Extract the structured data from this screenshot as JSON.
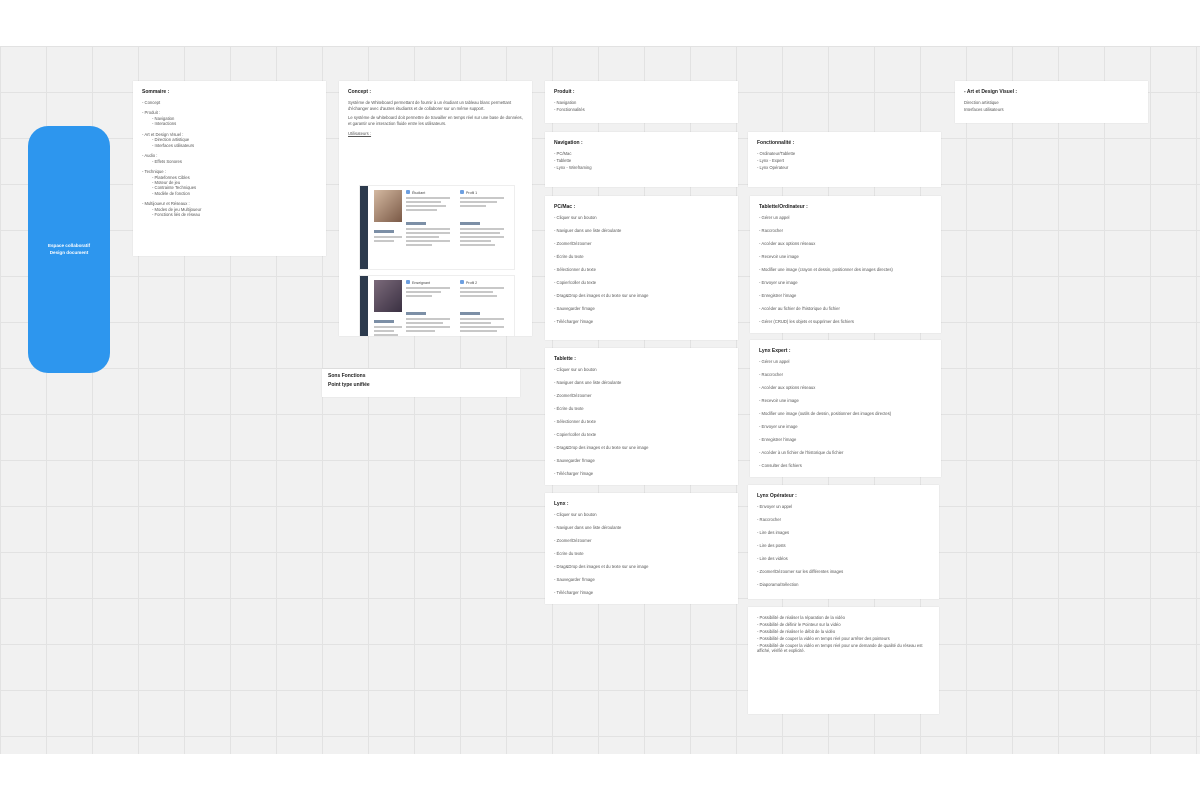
{
  "hero": {
    "title": "Espace collaboratif",
    "subtitle": "Design document"
  },
  "sommaire": {
    "title": "Sommaire :",
    "items": [
      {
        "text": "- Concept",
        "level": 0
      },
      {
        "text": "- Produit :",
        "level": 0
      },
      {
        "text": "- Navigation",
        "level": 1
      },
      {
        "text": "- Interactions",
        "level": 1
      },
      {
        "text": "- Art et Design Visuel :",
        "level": 0
      },
      {
        "text": "- Direction artistique",
        "level": 1
      },
      {
        "text": "- Interfaces utilisateurs",
        "level": 1
      },
      {
        "text": "- Audio :",
        "level": 0
      },
      {
        "text": "- Effets Sonores",
        "level": 1
      },
      {
        "text": "- Technique :",
        "level": 0
      },
      {
        "text": "- Plateformes Cibles",
        "level": 1
      },
      {
        "text": "- Moteur de jeu",
        "level": 1
      },
      {
        "text": "- Contrainte Techniques",
        "level": 1
      },
      {
        "text": "- Modèle de fonction",
        "level": 1
      },
      {
        "text": "- Multijoueur et Réseaux :",
        "level": 0
      },
      {
        "text": "- Modes de jeu Multijoueur",
        "level": 1
      },
      {
        "text": "- Fonctions liés de réseau",
        "level": 1
      }
    ]
  },
  "concept": {
    "title": "Concept :",
    "para1": "Système de Whiteboard permettant de fournir à un étudiant un tableau blanc permettant d'échanger avec d'autres étudiants et de collaborer sur un même support.",
    "para2": "Le système de whiteboard doit permettre de travailler en temps réel sur une base de données, et garantir une interaction fluide entre les utilisateurs.",
    "link": "Utilisateurs :",
    "persona1": {
      "name": "Étudiant",
      "tag": "Profil 1"
    },
    "persona2": {
      "name": "Enseignant",
      "tag": "Profil 2"
    }
  },
  "produit": {
    "title": "Produit :",
    "items": [
      "- Navigation",
      "- Fonctionnalités"
    ]
  },
  "navigation": {
    "title": "Navigation :",
    "items": [
      "- PC/Mac",
      "- Tablette",
      "- Lynx - Wireframing"
    ]
  },
  "fonctionnalite": {
    "title": "Fonctionnalité :",
    "items": [
      "- Ordinateur/Tablette",
      "- Lynx - Expert",
      "- Lynx Opérateur"
    ]
  },
  "pcmac": {
    "title": "PC/Mac :",
    "items": [
      "- Cliquer sur un bouton",
      "- Naviguer dans une liste déroulante",
      "- Zoomer/Dézoomer",
      "- Écrire du texte",
      "- Sélectionner du texte",
      "- Copier/coller du texte",
      "- Drag&Drop des images et du texte sur une image",
      "- Sauvegarder l'image",
      "- Télécharger l'image"
    ]
  },
  "tablette": {
    "title": "Tablette :",
    "items": [
      "- Cliquer sur un bouton",
      "- Naviguer dans une liste déroulante",
      "- Zoomer/Dézoomer",
      "- Écrire du texte",
      "- Sélectionner du texte",
      "- Copier/coller du texte",
      "- Drag&Drop des images et du texte sur une image",
      "- Sauvegarder l'image",
      "- Télécharger l'image"
    ]
  },
  "lynx": {
    "title": "Lynx :",
    "items": [
      "- Cliquer sur un bouton",
      "- Naviguer dans une liste déroulante",
      "- Zoomer/Dézoomer",
      "- Écrire du texte",
      "- Drag&Drop des images et du texte sur une image",
      "- Sauvegarder l'image",
      "- Télécharger l'image"
    ]
  },
  "ordinateur": {
    "title": "Tablette/Ordinateur :",
    "items": [
      "- Gérer un appel",
      "- Raccrocher",
      "- Accéder aux options réseaux",
      "- Recevoir une image",
      "- Modifier une image (crayon et dessin, positionner des images directes)",
      "- Envoyer une image",
      "- Enregistrer l'image",
      "- Accéder au fichier de l'historique du fichier",
      "- Gérer (CRUD) les objets et supprimer des fichiers"
    ]
  },
  "lynxexpert": {
    "title": "Lynx Expert :",
    "items": [
      "- Gérer un appel",
      "- Raccrocher",
      "- Accéder aux options réseaux",
      "- Recevoir une image",
      "- Modifier une image (outils de dessin, positionner des images directes)",
      "- Envoyer une image",
      "- Enregistrer l'image",
      "- Accéder à un fichier de l'historique du fichier",
      "- Consulter des fichiers"
    ]
  },
  "lynxoperateur": {
    "title": "Lynx Opérateur :",
    "items": [
      "- Envoyer un appel",
      "- Raccrocher",
      "- Lire des images",
      "- Lire des posts",
      "- Lire des vidéos",
      "- Zoomer/Dézoomer sur les différentes images",
      "- Diaporama/Sélection"
    ]
  },
  "notes": {
    "items": [
      "- Possibilité de réaliser la réparation de la vidéo",
      "- Possibilité de définir le Pointeur sur la vidéo",
      "- Possibilité de réaliser le débit de la vidéo",
      "- Possibilité de couper la vidéo en temps réel pour arrêter des pointeurs",
      "- Possibilité de couper la vidéo en temps réel pour une demande de qualité du réseau est affiché, vérifié et explicité."
    ]
  },
  "artdesign": {
    "title": "- Art et Design Visuel :",
    "items": [
      "Direction artistique",
      "Interfaces utilisateurs"
    ]
  },
  "sonfeatures": {
    "title": "Sons Fonctions",
    "subtitle": "Point type unifiée"
  },
  "colors": {
    "hero": "#2d96ee",
    "board": "#f1f1f1",
    "grid": "#e2e2e2"
  }
}
